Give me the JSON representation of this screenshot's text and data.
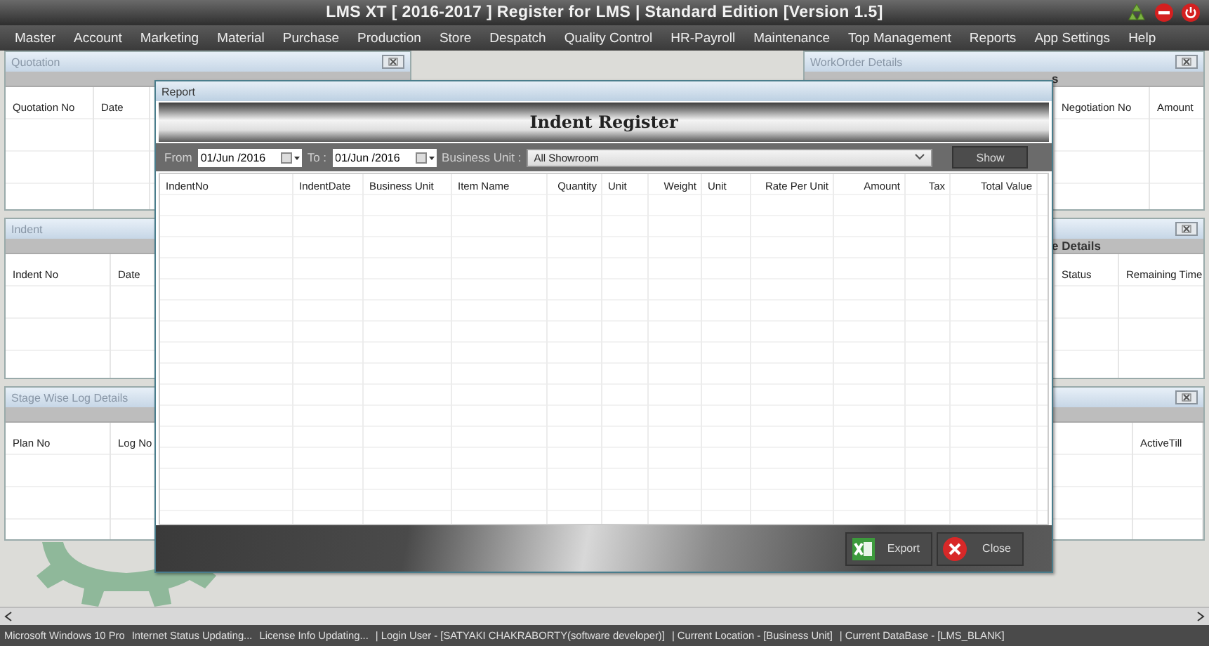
{
  "window": {
    "title": "LMS XT [ 2016-2017 ] Register for LMS | Standard Edition [Version 1.5]"
  },
  "menu": [
    "Master",
    "Account",
    "Marketing",
    "Material",
    "Purchase",
    "Production",
    "Store",
    "Despatch",
    "Quality Control",
    "HR-Payroll",
    "Maintenance",
    "Top Management",
    "Reports",
    "App Settings",
    "Help"
  ],
  "quotation_panel": {
    "title": "Quotation",
    "columns": [
      "Quotation No",
      "Date"
    ]
  },
  "workorder_panel": {
    "title": "WorkOrder Details",
    "heading": "s",
    "columns": [
      "Negotiation No",
      "Amount"
    ]
  },
  "indent_panel": {
    "title": "Indent",
    "columns": [
      "Indent No",
      "Date"
    ]
  },
  "right_middle_panel": {
    "heading": "e Details",
    "columns": [
      "Status",
      "Remaining Time"
    ]
  },
  "stage_panel": {
    "title": "Stage Wise Log Details",
    "columns": [
      "Plan No",
      "Log No"
    ]
  },
  "right_bottom_panel": {
    "columns": [
      "ActiveTill"
    ]
  },
  "report_dialog": {
    "title": "Report",
    "heading": "Indent Register",
    "filter": {
      "from_label": "From",
      "from": "01/Jun /2016",
      "to_label": "To :",
      "to": "01/Jun /2016",
      "unit_label": "Business Unit :",
      "unit": "All Showroom",
      "show": "Show"
    },
    "columns": [
      {
        "label": "IndentNo",
        "numeric": false
      },
      {
        "label": "IndentDate",
        "numeric": false
      },
      {
        "label": "Business Unit",
        "numeric": false
      },
      {
        "label": "Item Name",
        "numeric": false
      },
      {
        "label": "Quantity",
        "numeric": true
      },
      {
        "label": "Unit",
        "numeric": false
      },
      {
        "label": "Weight",
        "numeric": true
      },
      {
        "label": "Unit",
        "numeric": false
      },
      {
        "label": "Rate Per Unit",
        "numeric": true
      },
      {
        "label": "Amount",
        "numeric": true
      },
      {
        "label": "Tax",
        "numeric": true
      },
      {
        "label": "Total Value",
        "numeric": true
      }
    ],
    "buttons": [
      {
        "label": "Export",
        "kind": "export"
      },
      {
        "label": "Close",
        "kind": "close"
      }
    ]
  },
  "status_bar": [
    "Microsoft Windows 10 Pro",
    "Internet Status Updating...",
    "License Info Updating...",
    "| Login User - [SATYAKI CHAKRABORTY(software developer)]",
    "| Current Location - [Business Unit]",
    "| Current DataBase - [LMS_BLANK]"
  ]
}
